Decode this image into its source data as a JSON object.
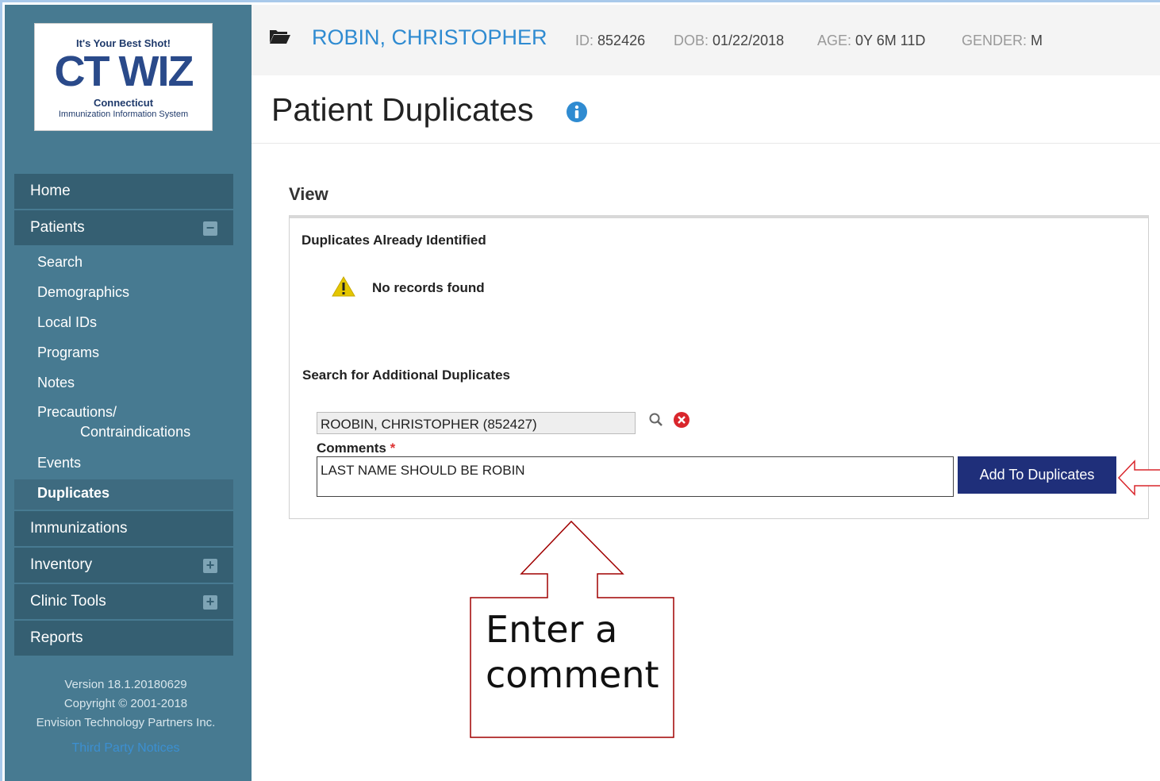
{
  "logo": {
    "tagline": "It's Your Best Shot!",
    "wordmark": "CT WIZ",
    "state": "Connecticut",
    "system": "Immunization Information System"
  },
  "nav": {
    "home": "Home",
    "patients": "Patients",
    "patients_toggle": "−",
    "patient_subitems": {
      "search": "Search",
      "demographics": "Demographics",
      "local_ids": "Local IDs",
      "programs": "Programs",
      "notes": "Notes",
      "precautions_line1": "Precautions/",
      "precautions_line2": "Contraindications",
      "events": "Events",
      "duplicates": "Duplicates"
    },
    "immunizations": "Immunizations",
    "inventory": "Inventory",
    "inventory_toggle": "+",
    "clinic_tools": "Clinic Tools",
    "clinic_tools_toggle": "+",
    "reports": "Reports"
  },
  "footer": {
    "version": "Version 18.1.20180629",
    "copyright": "Copyright © 2001-2018",
    "company": "Envision Technology Partners Inc.",
    "third_party": "Third Party Notices"
  },
  "patient": {
    "name": "ROBIN, CHRISTOPHER",
    "id_label": "ID:",
    "id": "852426",
    "dob_label": "DOB:",
    "dob": "01/22/2018",
    "age_label": "AGE:",
    "age": "0Y 6M 11D",
    "gender_label": "GENDER:",
    "gender": "M"
  },
  "page": {
    "title": "Patient Duplicates",
    "view_label": "View",
    "dup_heading": "Duplicates Already Identified",
    "no_records": "No records found",
    "search_heading": "Search for Additional Duplicates",
    "search_value": "ROOBIN, CHRISTOPHER (852427)",
    "comments_label": "Comments",
    "required_mark": "*",
    "comment_value": "LAST NAME SHOULD BE ROBIN",
    "add_button": "Add To Duplicates"
  },
  "annotation": {
    "line1": "Enter a",
    "line2": "comment"
  },
  "colors": {
    "sidebar": "#477a91",
    "nav_item": "#355f72",
    "link_blue": "#2f8bd1",
    "button": "#1f2f7a",
    "annotation_red": "#c00000"
  }
}
